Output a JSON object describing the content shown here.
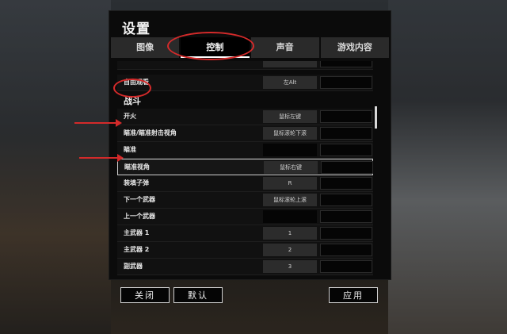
{
  "window": {
    "title": "设置"
  },
  "tabs": [
    {
      "label": "图像",
      "active": false
    },
    {
      "label": "控制",
      "active": true
    },
    {
      "label": "声音",
      "active": false
    },
    {
      "label": "游戏内容",
      "active": false
    }
  ],
  "rows": {
    "free_look": {
      "label": "自由观看",
      "key1": "左Alt"
    },
    "fire": {
      "label": "开火",
      "key1": "鼠标左键"
    },
    "aim_scope_toggle": {
      "label": "瞄准/瞄准射击视角",
      "key1": "鼠标滚轮下滚"
    },
    "aim": {
      "label": "瞄准",
      "key1": ""
    },
    "aim_view": {
      "label": "瞄准视角",
      "key1": "鼠标右键"
    },
    "reload": {
      "label": "装填子弹",
      "key1": "R"
    },
    "next_weapon": {
      "label": "下一个武器",
      "key1": "鼠标滚轮上滚"
    },
    "prev_weapon": {
      "label": "上一个武器",
      "key1": ""
    },
    "primary1": {
      "label": "主武器 1",
      "key1": "1"
    },
    "primary2": {
      "label": "主武器 2",
      "key1": "2"
    },
    "secondary": {
      "label": "副武器",
      "key1": "3"
    }
  },
  "sections": {
    "combat": "战斗"
  },
  "buttons": {
    "close": "关闭",
    "default": "默认",
    "apply": "应用"
  },
  "annotation_color": "#d42a2a"
}
